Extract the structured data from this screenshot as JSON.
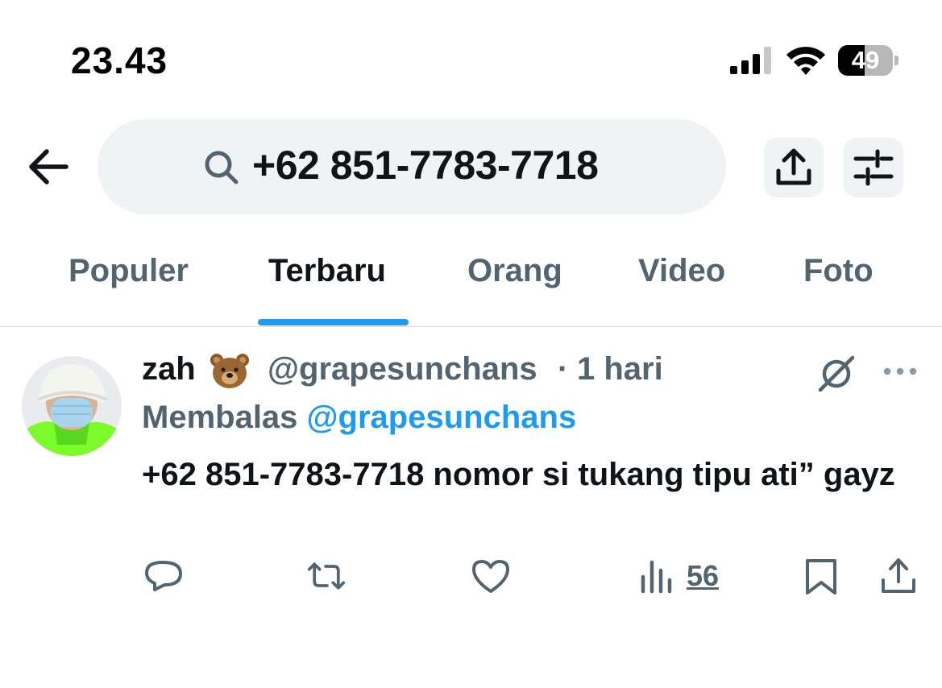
{
  "status_bar": {
    "time": "23.43",
    "battery_level": "49",
    "battery_fraction": 0.49
  },
  "header": {
    "back_icon": "arrow-left-icon",
    "search_icon": "search-icon",
    "search_query": "+62 851-7783-7718",
    "share_icon": "share-icon",
    "filter_icon": "sliders-icon"
  },
  "tabs": [
    {
      "label": "Populer",
      "active": false
    },
    {
      "label": "Terbaru",
      "active": true
    },
    {
      "label": "Orang",
      "active": false
    },
    {
      "label": "Video",
      "active": false
    },
    {
      "label": "Foto",
      "active": false
    }
  ],
  "tweet": {
    "display_name": "zah",
    "name_emoji": "bear-face",
    "handle": "@grapesunchans",
    "separator": "·",
    "age": "1 hari",
    "reply_prefix": "Membalas",
    "reply_to": "@grapesunchans",
    "text": "+62 851-7783-7718 nomor si tukang tipu ati” gayz",
    "actions": {
      "reply_icon": "reply-bubble-icon",
      "retweet_icon": "retweet-icon",
      "like_icon": "heart-icon",
      "views_icon": "views-chart-icon",
      "views_count": "56",
      "bookmark_icon": "bookmark-icon",
      "share_icon": "share-icon"
    }
  },
  "colors": {
    "accent": "#1d9bf0",
    "text_primary": "#0f1419",
    "text_secondary": "#536471",
    "search_bg": "#eff3f4"
  }
}
